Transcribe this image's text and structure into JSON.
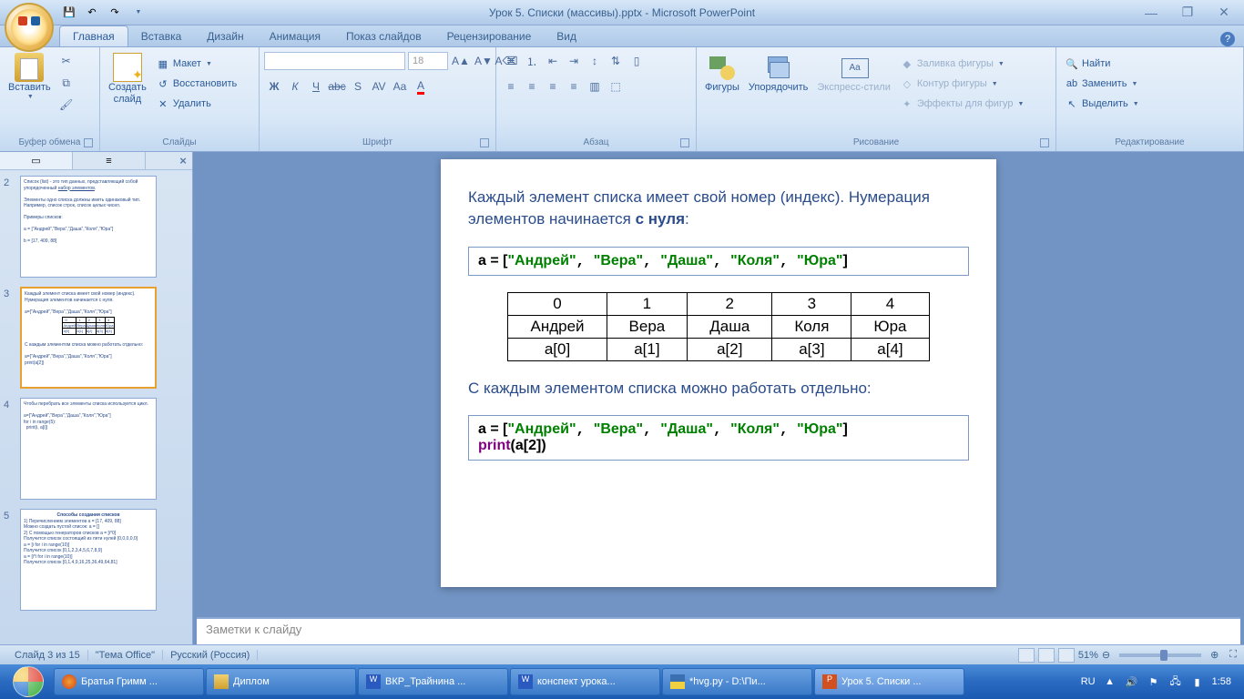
{
  "titlebar": {
    "title": "Урок 5. Списки (массивы).pptx - Microsoft PowerPoint"
  },
  "tabs": {
    "home": "Главная",
    "insert": "Вставка",
    "design": "Дизайн",
    "animation": "Анимация",
    "slideshow": "Показ слайдов",
    "review": "Рецензирование",
    "view": "Вид"
  },
  "ribbon": {
    "clipboard": {
      "label": "Буфер обмена",
      "paste": "Вставить"
    },
    "slides": {
      "label": "Слайды",
      "new": "Создать\nслайд",
      "layout": "Макет",
      "reset": "Восстановить",
      "delete": "Удалить"
    },
    "font": {
      "label": "Шрифт",
      "size": "18"
    },
    "paragraph": {
      "label": "Абзац"
    },
    "drawing": {
      "label": "Рисование",
      "shapes": "Фигуры",
      "arrange": "Упорядочить",
      "styles": "Экспресс-стили",
      "fill": "Заливка фигуры",
      "outline": "Контур фигуры",
      "effects": "Эффекты для фигур"
    },
    "editing": {
      "label": "Редактирование",
      "find": "Найти",
      "replace": "Заменить",
      "select": "Выделить"
    }
  },
  "thumbs": [
    "2",
    "3",
    "4",
    "5"
  ],
  "slide": {
    "h1a": "Каждый элемент списка имеет свой номер (индекс). Нумерация элементов начинается ",
    "h1b": "с нуля",
    "code1_a": "a",
    "code1_eq": " = [",
    "names": [
      "\"Андрей\"",
      "\"Вера\"",
      "\"Даша\"",
      "\"Коля\"",
      "\"Юра\""
    ],
    "code1_close": "]",
    "table": {
      "idx": [
        "0",
        "1",
        "2",
        "3",
        "4"
      ],
      "vals": [
        "Андрей",
        "Вера",
        "Даша",
        "Коля",
        "Юра"
      ],
      "refs": [
        "a[0]",
        "a[1]",
        "a[2]",
        "a[3]",
        "a[4]"
      ]
    },
    "h2": "С каждым элементом списка можно работать отдельно:",
    "code2_print": "print",
    "code2_arg": "(a[2])"
  },
  "notes": "Заметки к слайду",
  "status": {
    "slide": "Слайд 3 из 15",
    "theme": "\"Тема Office\"",
    "lang": "Русский (Россия)",
    "zoom": "51%"
  },
  "taskbar": {
    "items": [
      "Братья Гримм ...",
      "Диплом",
      "ВКР_Трайнина ...",
      "конспект урока...",
      "*hvg.py - D:\\Пи...",
      "Урок 5. Списки ..."
    ],
    "lang": "RU",
    "time": "1:58"
  }
}
